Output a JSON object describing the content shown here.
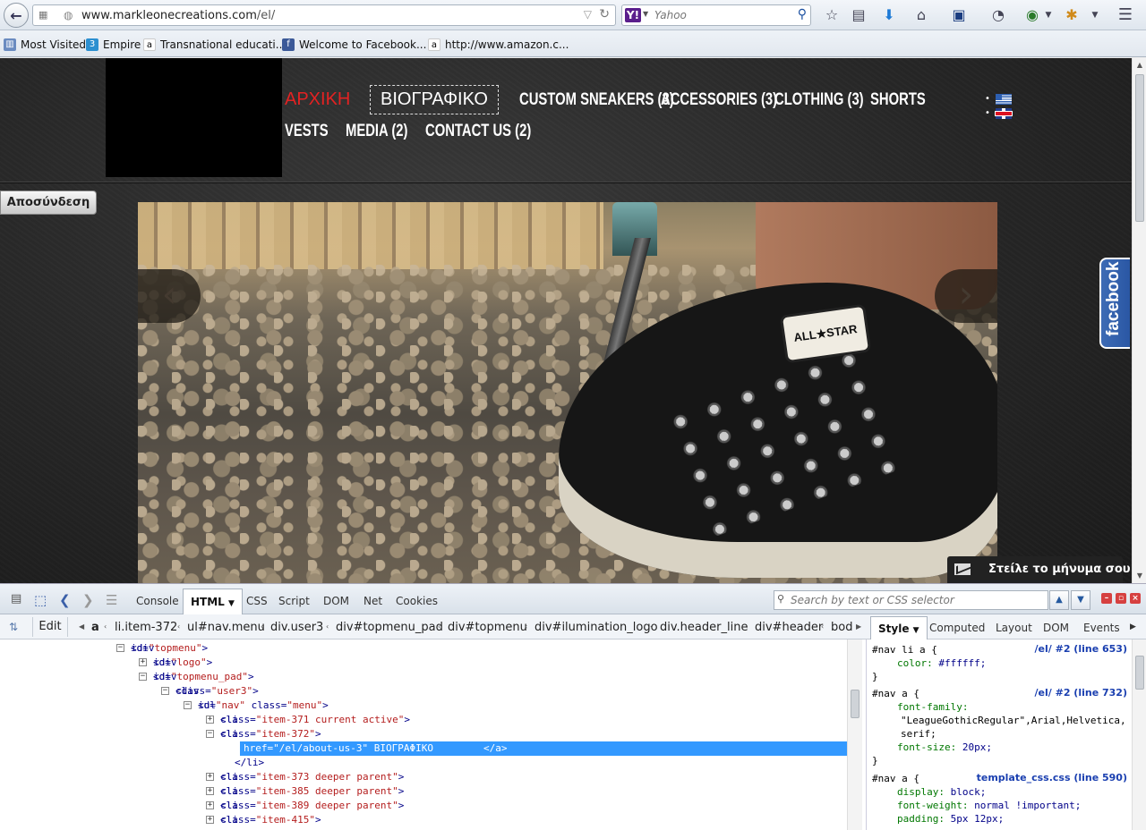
{
  "browser": {
    "url_host": "www.markleonecreations.com",
    "url_path": "/el/",
    "search_engine_letter": "Y!",
    "search_placeholder": "Yahoo",
    "bookmarks": [
      {
        "label": "Most Visited",
        "icon": "most-visited-icon"
      },
      {
        "label": "Empire",
        "icon": "empire-icon"
      },
      {
        "label": "Transnational educati...",
        "icon": "amazon-icon"
      },
      {
        "label": "Welcome to Facebook...",
        "icon": "facebook-icon"
      },
      {
        "label": "http://www.amazon.c...",
        "icon": "amazon-icon"
      }
    ]
  },
  "site": {
    "nav": {
      "home": "ΑΡΧΙΚΗ",
      "bio": "ΒΙΟΓΡΑΦΙΚΟ",
      "custom_sneakers": "CUSTOM SNEAKERS (3)",
      "accessories": "ACCESSORIES (3)",
      "clothing": "CLOTHING (3)",
      "shorts": "SHORTS",
      "vests": "VESTS",
      "media": "MEDIA (2)",
      "contact": "CONTACT US (2)"
    },
    "logout_label": "Αποσύνδεση",
    "shoe_patch": "ALL★STAR",
    "facebook_tab": "facebook",
    "message_label": "Στείλε το μήνυμα σου",
    "colors": {
      "home_active": "#e32222",
      "facebook": "#3d6bb5"
    }
  },
  "firebug": {
    "tabs": [
      "Console",
      "HTML",
      "CSS",
      "Script",
      "DOM",
      "Net",
      "Cookies"
    ],
    "search_placeholder": "Search by text or CSS selector",
    "edit_label": "Edit",
    "breadcrumb": [
      "a",
      "li.item-372",
      "ul#nav.menu",
      "div.user3",
      "div#topmenu_pad",
      "div#topmenu",
      "div#ilumination_logo",
      "div.header_line",
      "div#header",
      "bod"
    ],
    "side_tabs": [
      "Style",
      "Computed",
      "Layout",
      "DOM",
      "Events"
    ],
    "tree": [
      {
        "toggle": "−",
        "parts": [
          [
            "tag",
            "<div "
          ],
          [
            "attr",
            "id="
          ],
          [
            "val",
            "\"topmenu\""
          ],
          [
            "tag",
            ">"
          ]
        ]
      },
      {
        "toggle": "+",
        "parts": [
          [
            "tag",
            "<div "
          ],
          [
            "attr",
            "id="
          ],
          [
            "val",
            "\"logo\""
          ],
          [
            "tag",
            ">"
          ]
        ]
      },
      {
        "toggle": "−",
        "parts": [
          [
            "tag",
            "<div "
          ],
          [
            "attr",
            "id="
          ],
          [
            "val",
            "\"topmenu_pad\""
          ],
          [
            "tag",
            ">"
          ]
        ]
      },
      {
        "toggle": "−",
        "parts": [
          [
            "tag",
            "<div "
          ],
          [
            "attr",
            "class="
          ],
          [
            "val",
            "\"user3\""
          ],
          [
            "tag",
            ">"
          ]
        ]
      },
      {
        "toggle": "−",
        "parts": [
          [
            "tag",
            "<ul "
          ],
          [
            "attr",
            "id="
          ],
          [
            "val",
            "\"nav\""
          ],
          [
            "attr",
            " class="
          ],
          [
            "val",
            "\"menu\""
          ],
          [
            "tag",
            ">"
          ]
        ]
      },
      {
        "toggle": "+",
        "parts": [
          [
            "tag",
            "<li "
          ],
          [
            "attr",
            "class="
          ],
          [
            "val",
            "\"item-371 current active\""
          ],
          [
            "tag",
            ">"
          ]
        ]
      },
      {
        "toggle": "−",
        "parts": [
          [
            "tag",
            "<li "
          ],
          [
            "attr",
            "class="
          ],
          [
            "val",
            "\"item-372\""
          ],
          [
            "tag",
            ">"
          ]
        ]
      },
      {
        "toggle": "",
        "parts": [
          [
            "tag",
            "<a "
          ],
          [
            "attr",
            "href="
          ],
          [
            "val",
            "\"/el/about-us-3\""
          ],
          [
            "tag",
            ">"
          ],
          [
            "txt",
            " ΒΙΟΓΡΑΦΙΚΟ "
          ],
          [
            "tag",
            "</a>"
          ]
        ]
      },
      {
        "toggle": "",
        "parts": [
          [
            "tag",
            "</li>"
          ]
        ]
      },
      {
        "toggle": "+",
        "parts": [
          [
            "tag",
            "<li "
          ],
          [
            "attr",
            "class="
          ],
          [
            "val",
            "\"item-373 deeper parent\""
          ],
          [
            "tag",
            ">"
          ]
        ]
      },
      {
        "toggle": "+",
        "parts": [
          [
            "tag",
            "<li "
          ],
          [
            "attr",
            "class="
          ],
          [
            "val",
            "\"item-385 deeper parent\""
          ],
          [
            "tag",
            ">"
          ]
        ]
      },
      {
        "toggle": "+",
        "parts": [
          [
            "tag",
            "<li "
          ],
          [
            "attr",
            "class="
          ],
          [
            "val",
            "\"item-389 deeper parent\""
          ],
          [
            "tag",
            ">"
          ]
        ]
      },
      {
        "toggle": "+",
        "parts": [
          [
            "tag",
            "<li "
          ],
          [
            "attr",
            "class="
          ],
          [
            "val",
            "\"item-415\""
          ],
          [
            "tag",
            ">"
          ]
        ]
      }
    ],
    "css": {
      "rule1_selector": "#nav li a {",
      "rule1_src": "/el/ #2 (line 653)",
      "rule1_prop": "color:",
      "rule1_val": "#ffffff;",
      "close": "}",
      "rule2_selector": "#nav a {",
      "rule2_src": "/el/ #2 (line 732)",
      "rule2_prop1": "font-family:",
      "rule2_val1": "\"LeagueGothicRegular\",Arial,Helvetica,",
      "rule2_val1b": "serif;",
      "rule2_prop2": "font-size:",
      "rule2_val2": "20px;",
      "rule3_selector": "#nav a {",
      "rule3_src": "template_css.css (line 590)",
      "rule3_prop1": "display:",
      "rule3_val1": "block;",
      "rule3_prop2": "font-weight:",
      "rule3_val2": "normal !important;",
      "rule3_prop3": "padding:",
      "rule3_val3": "5px 12px;"
    }
  }
}
